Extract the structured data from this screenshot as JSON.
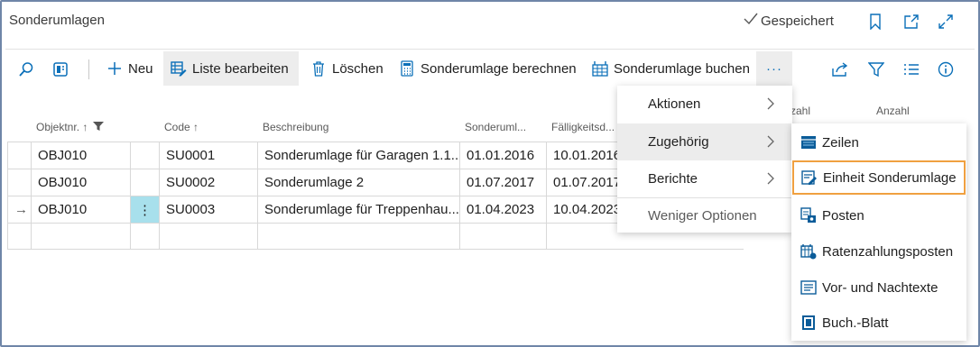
{
  "header": {
    "title": "Sonderumlagen",
    "saved_label": "Gespeichert"
  },
  "actionbar": {
    "new_label": "Neu",
    "edit_list_label": "Liste bearbeiten",
    "delete_label": "Löschen",
    "calc_label": "Sonderumlage berechnen",
    "post_label": "Sonderumlage buchen",
    "more_label": "···"
  },
  "columns": {
    "object_no": "Objektnr. ↑",
    "code": "Code ↑",
    "description": "Beschreibung",
    "special_date": "Sonderuml...",
    "due_date": "Fälligkeitsd...",
    "hidden_count_partial": "zahl",
    "count": "Anzahl"
  },
  "rows": [
    {
      "object_no": "OBJ010",
      "code": "SU0001",
      "description": "Sonderumlage für Garagen 1.1...",
      "special_date": "01.01.2016",
      "due_date": "10.01.2016"
    },
    {
      "object_no": "OBJ010",
      "code": "SU0002",
      "description": "Sonderumlage 2",
      "special_date": "01.07.2017",
      "due_date": "01.07.2017"
    },
    {
      "object_no": "OBJ010",
      "code": "SU0003",
      "description": "Sonderumlage für Treppenhau...",
      "special_date": "01.04.2023",
      "due_date": "10.04.2023",
      "current_marker": "→",
      "row_menu": "⋮"
    }
  ],
  "menu": {
    "items": [
      {
        "label": "Aktionen"
      },
      {
        "label": "Zugehörig"
      },
      {
        "label": "Berichte"
      },
      {
        "label": "Weniger Optionen"
      }
    ]
  },
  "submenu": {
    "items": [
      {
        "label": "Zeilen"
      },
      {
        "label": "Einheit Sonderumlage"
      },
      {
        "label": "Posten"
      },
      {
        "label": "Ratenzahlungsposten"
      },
      {
        "label": "Vor- und Nachtexte"
      },
      {
        "label": "Buch.-Blatt"
      }
    ]
  },
  "colors": {
    "accent": "#0a6fb8",
    "frame": "#6f86a8",
    "selection_outline": "#f0a040",
    "row_menu_bg": "#a8e0ec"
  }
}
